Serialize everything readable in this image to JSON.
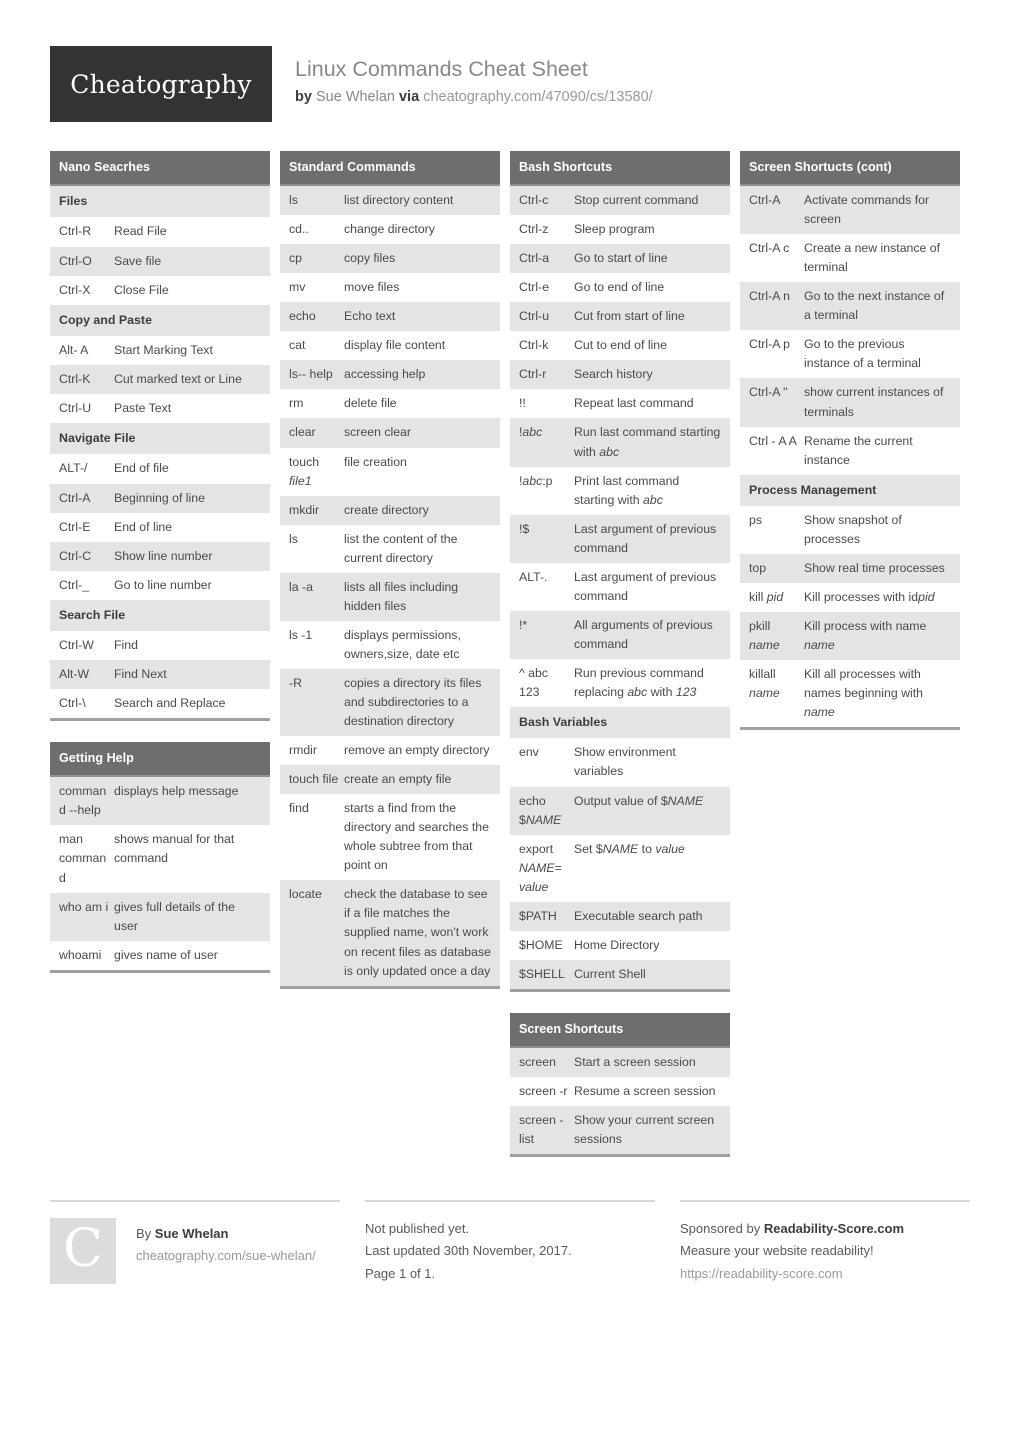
{
  "header": {
    "logo_text": "Cheatography",
    "title": "Linux Commands Cheat Sheet",
    "by_label": "by",
    "author": "Sue Whelan",
    "via_label": "via",
    "url": "cheatography.com/47090/cs/13580/"
  },
  "columns": [
    {
      "blocks": [
        {
          "title": "Nano Seacrhes",
          "rows": [
            {
              "type": "subhead",
              "text": "Files"
            },
            {
              "type": "row",
              "k": "Ctrl-R",
              "v": "Read File"
            },
            {
              "type": "row",
              "k": "Ctrl-O",
              "v": "Save file"
            },
            {
              "type": "row",
              "k": "Ctrl-X",
              "v": "Close File"
            },
            {
              "type": "subhead",
              "text": "Copy and Paste"
            },
            {
              "type": "row",
              "k": "Alt- A",
              "v": "Start Marking Text"
            },
            {
              "type": "row",
              "k": "Ctrl-K",
              "v": "Cut marked text or Line"
            },
            {
              "type": "row",
              "k": "Ctrl-U",
              "v": "Paste Text"
            },
            {
              "type": "subhead",
              "text": "Navigate File"
            },
            {
              "type": "row",
              "k": "ALT-/",
              "v": "End of file"
            },
            {
              "type": "row",
              "k": "Ctrl-A",
              "v": "Beginning of line"
            },
            {
              "type": "row",
              "k": "Ctrl-E",
              "v": "End of line"
            },
            {
              "type": "row",
              "k": "Ctrl-C",
              "v": "Show line number"
            },
            {
              "type": "row",
              "k": "Ctrl-_",
              "v": "Go to line number"
            },
            {
              "type": "subhead",
              "text": "Search File"
            },
            {
              "type": "row",
              "k": "Ctrl-W",
              "v": "Find"
            },
            {
              "type": "row",
              "k": "Alt-W",
              "v": "Find Next"
            },
            {
              "type": "row",
              "k": "Ctrl-\\",
              "v": "Search and Replace"
            }
          ]
        },
        {
          "title": "Getting Help",
          "rows": [
            {
              "type": "row",
              "k": "command --help",
              "v": "displays help message"
            },
            {
              "type": "row",
              "k": "man command",
              "v": "shows manual for that command"
            },
            {
              "type": "row",
              "k": "who am i",
              "v": "gives full details of the user"
            },
            {
              "type": "row",
              "k": "whoami",
              "v": "gives name of user"
            }
          ]
        }
      ]
    },
    {
      "blocks": [
        {
          "title": "Standard Commands",
          "rows": [
            {
              "type": "row",
              "k": "ls",
              "v": "list directory content"
            },
            {
              "type": "row",
              "k": "cd..",
              "v": "change directory"
            },
            {
              "type": "row",
              "k": "cp",
              "v": "copy files"
            },
            {
              "type": "row",
              "k": "mv",
              "v": "move files"
            },
            {
              "type": "row",
              "k": "echo",
              "v": "Echo text"
            },
            {
              "type": "row",
              "k": "cat",
              "v": "display file content"
            },
            {
              "type": "row",
              "k": "ls-- help",
              "v": "accessing help"
            },
            {
              "type": "row",
              "k": "rm",
              "v": "delete file"
            },
            {
              "type": "row",
              "k": "clear",
              "v": "screen clear"
            },
            {
              "type": "row",
              "k_html": "touch <i>file1</i>",
              "v": "file creation"
            },
            {
              "type": "row",
              "k": "mkdir",
              "v": "create directory"
            },
            {
              "type": "row",
              "k": "ls",
              "v": "list the content of the current directory"
            },
            {
              "type": "row",
              "k": "la -a",
              "v": "lists all files including hidden files"
            },
            {
              "type": "row",
              "k": "ls -1",
              "v": "displays permissions, owners,size, date etc"
            },
            {
              "type": "row",
              "k": "-R",
              "v": "copies a directory its files and subdirectories to a destination directory"
            },
            {
              "type": "row",
              "k": "rmdir",
              "v": "remove an empty directory"
            },
            {
              "type": "row",
              "k": "touch file",
              "v": "create an empty file"
            },
            {
              "type": "row",
              "k": "find",
              "v": "starts a find from the directory and searches the whole subtree from that point on"
            },
            {
              "type": "row",
              "k": "locate",
              "v": "check the database to see if a file matches the supplied name, won't work on recent files as database is only updated once a day"
            }
          ]
        }
      ]
    },
    {
      "blocks": [
        {
          "title": "Bash Shortcuts",
          "rows": [
            {
              "type": "row",
              "k": "Ctrl-c",
              "v": "Stop current command"
            },
            {
              "type": "row",
              "k": "Ctrl-z",
              "v": "Sleep program"
            },
            {
              "type": "row",
              "k": "Ctrl-a",
              "v": "Go to start of line"
            },
            {
              "type": "row",
              "k": "Ctrl-e",
              "v": "Go to end of line"
            },
            {
              "type": "row",
              "k": "Ctrl-u",
              "v": "Cut from start of line"
            },
            {
              "type": "row",
              "k": "Ctrl-k",
              "v": "Cut to end of line"
            },
            {
              "type": "row",
              "k": "Ctrl-r",
              "v": "Search history"
            },
            {
              "type": "row",
              "k": "!!",
              "v": "Repeat last command"
            },
            {
              "type": "row",
              "k_html": "!<i>abc</i>",
              "v_html": "Run last command starting with <i>abc</i>"
            },
            {
              "type": "row",
              "k_html": "!<i>abc</i>:p",
              "v_html": "Print last command starting with <i>abc</i>"
            },
            {
              "type": "row",
              "k": "!$",
              "v": "Last argument of previous command"
            },
            {
              "type": "row",
              "k": "ALT-.",
              "v": "Last argument of previous command"
            },
            {
              "type": "row",
              "k": "!*",
              "v": "All arguments of previous command"
            },
            {
              "type": "row",
              "k": "^ abc 123",
              "v_html": "Run previous command replacing <i>abc</i> with <i>123</i>"
            },
            {
              "type": "subhead",
              "text": "Bash Variables"
            },
            {
              "type": "row",
              "k": "env",
              "v": "Show environment variables"
            },
            {
              "type": "row",
              "k_html": "echo $<i>NAME</i>",
              "v_html": "Output value of $<i>NAME</i>"
            },
            {
              "type": "row",
              "k_html": "export <i>NAME= value</i>",
              "v_html": "Set $<i>NAME</i> to <i>value</i>"
            },
            {
              "type": "row",
              "k": "$PATH",
              "v": "Executable search path"
            },
            {
              "type": "row",
              "k": "$HOME",
              "v": "Home Directory"
            },
            {
              "type": "row",
              "k": "$SHELL",
              "v": "Current Shell"
            }
          ]
        },
        {
          "title": "Screen Shortcuts",
          "rows": [
            {
              "type": "row",
              "k": "screen",
              "v": "Start a screen session"
            },
            {
              "type": "row",
              "k": "screen -r",
              "v": "Resume a screen session"
            },
            {
              "type": "row",
              "k": "screen -list",
              "v": "Show your current screen sessions"
            }
          ]
        }
      ]
    },
    {
      "blocks": [
        {
          "title": "Screen Shortucts (cont)",
          "rows": [
            {
              "type": "row",
              "k": "Ctrl-A",
              "v": "Activate commands for screen"
            },
            {
              "type": "row",
              "k": "Ctrl-A c",
              "v": "Create a new instance of terminal"
            },
            {
              "type": "row",
              "k": "Ctrl-A n",
              "v": "Go to the next instance of a terminal"
            },
            {
              "type": "row",
              "k": "Ctrl-A p",
              "v": "Go to the previous instance of a terminal"
            },
            {
              "type": "row",
              "k": "Ctrl-A \"",
              "v": "show current instances of terminals"
            },
            {
              "type": "row",
              "k": "Ctrl - A A",
              "v": "Rename the current instance"
            },
            {
              "type": "subhead",
              "text": "Process Management"
            },
            {
              "type": "row",
              "k": "ps",
              "v": "Show snapshot of processes"
            },
            {
              "type": "row",
              "k": "top",
              "v": "Show real time processes"
            },
            {
              "type": "row",
              "k_html": "kill <i>pid</i>",
              "v_html": "Kill processes with id<i>pid</i>"
            },
            {
              "type": "row",
              "k_html": "pkill <i>name</i>",
              "v_html": "Kill process with name <i>name</i>"
            },
            {
              "type": "row",
              "k_html": "killall <i>name</i>",
              "v_html": "Kill all processes with names beginning with <i>name</i>"
            }
          ]
        }
      ]
    }
  ],
  "footer": {
    "avatar_letter": "C",
    "by_prefix": "By ",
    "author": "Sue Whelan",
    "author_url": "cheatography.com/sue-whelan/",
    "publish_status": "Not published yet.",
    "last_updated": "Last updated 30th November, 2017.",
    "page_info": "Page 1 of 1.",
    "sponsor_prefix": "Sponsored by ",
    "sponsor_name": "Readability-Score.com",
    "sponsor_tagline": "Measure your website readability!",
    "sponsor_url": "https://readability-score.com"
  }
}
